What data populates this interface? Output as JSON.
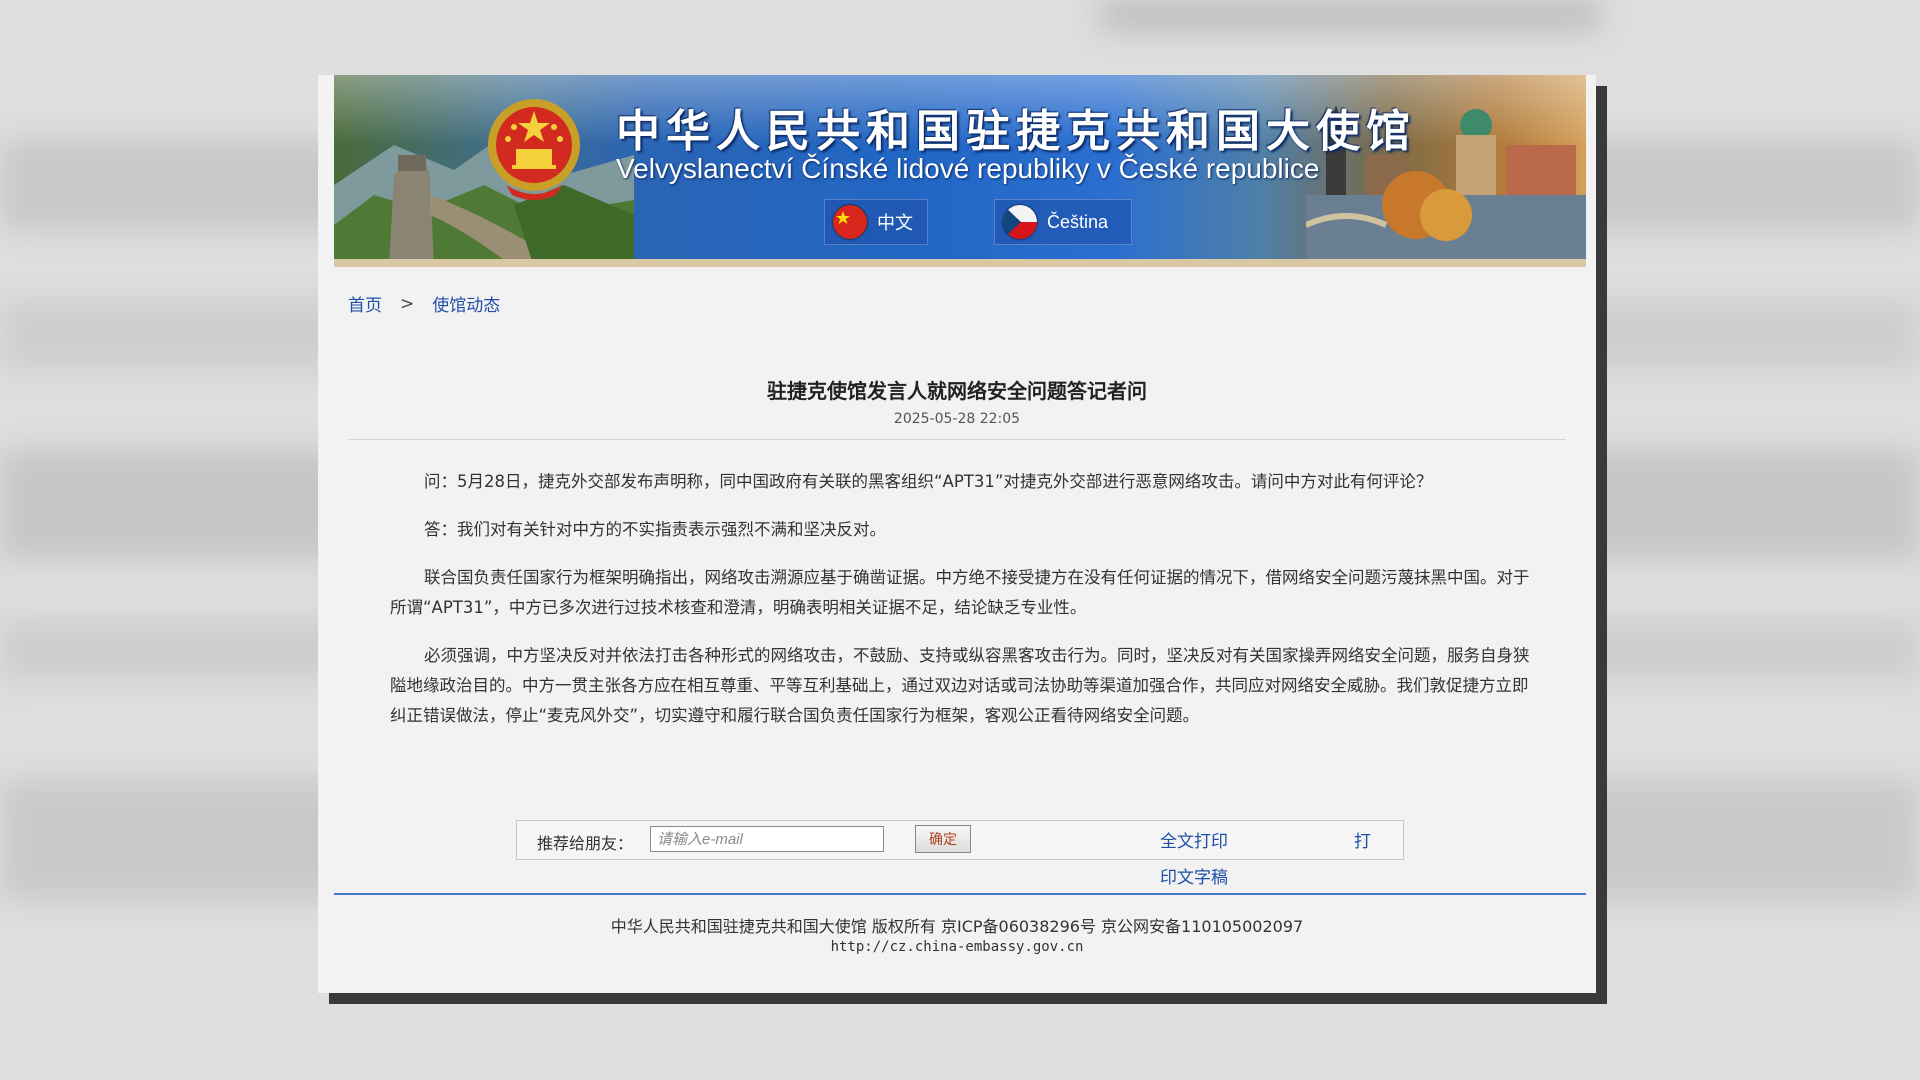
{
  "banner": {
    "title_zh": "中华人民共和国驻捷克共和国大使馆",
    "title_cz": "Velvyslanectví Čínské lidové republiky v České republice",
    "lang_zh": "中文",
    "lang_cz": "Čeština"
  },
  "breadcrumb": {
    "home": "首页",
    "separator": ">",
    "section": "使馆动态"
  },
  "article": {
    "title": "驻捷克使馆发言人就网络安全问题答记者问",
    "date": "2025-05-28 22:05",
    "paragraphs": [
      "问：5月28日，捷克外交部发布声明称，同中国政府有关联的黑客组织“APT31”对捷克外交部进行恶意网络攻击。请问中方对此有何评论？",
      "答：我们对有关针对中方的不实指责表示强烈不满和坚决反对。",
      "联合国负责任国家行为框架明确指出，网络攻击溯源应基于确凿证据。中方绝不接受捷方在没有任何证据的情况下，借网络安全问题污蔑抹黑中国。对于所谓“APT31”，中方已多次进行过技术核查和澄清，明确表明相关证据不足，结论缺乏专业性。",
      "必须强调，中方坚决反对并依法打击各种形式的网络攻击，不鼓励、支持或纵容黑客攻击行为。同时，坚决反对有关国家操弄网络安全问题，服务自身狭隘地缘政治目的。中方一贯主张各方应在相互尊重、平等互利基础上，通过双边对话或司法协助等渠道加强合作，共同应对网络安全威胁。我们敦促捷方立即纠正错误做法，停止“麦克风外交”，切实遵守和履行联合国负责任国家行为框架，客观公正看待网络安全问题。"
    ]
  },
  "recommend": {
    "label": "推荐给朋友：",
    "placeholder": "请输入e-mail",
    "confirm": "确定",
    "print_full": "全文打印",
    "print_close": "打",
    "print_draft": "印文字稿"
  },
  "footer": {
    "copyright": "中华人民共和国驻捷克共和国大使馆 版权所有 京ICP备06038296号 京公网安备110105002097",
    "url": "http://cz.china-embassy.gov.cn"
  },
  "colors": {
    "link": "#1f4fa8",
    "banner_blue": "#2266c4",
    "footer_rule": "#3d78c8",
    "flag_red": "#d8261c"
  }
}
